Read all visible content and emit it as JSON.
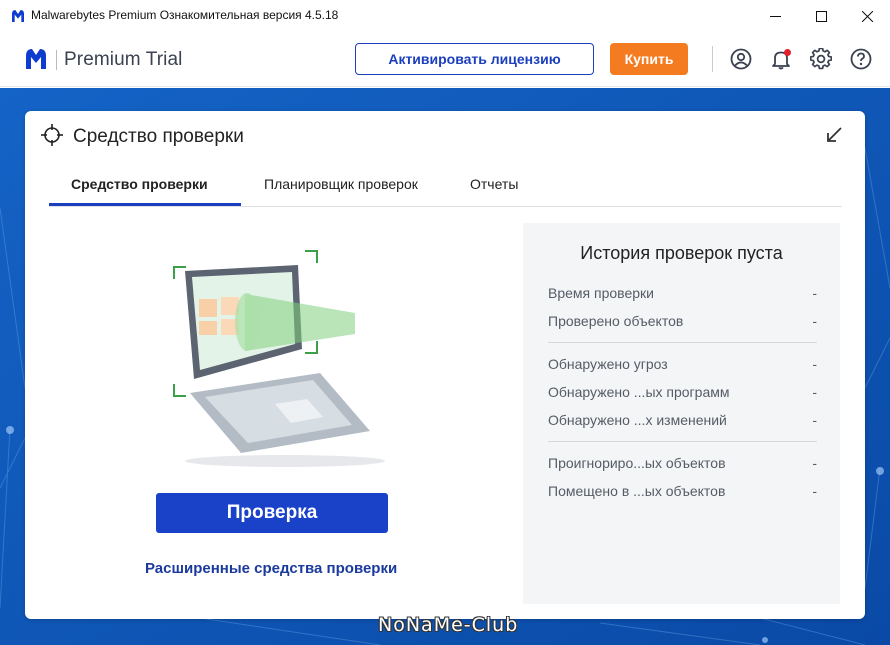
{
  "window": {
    "title": "Malwarebytes Premium Ознакомительная версия  4.5.18"
  },
  "header": {
    "brand": "Premium Trial",
    "activate_label": "Активировать лицензию",
    "buy_label": "Купить",
    "icons": [
      "account-icon",
      "notifications-icon",
      "settings-icon",
      "help-icon"
    ],
    "notification_dot_color": "#e0202a"
  },
  "card": {
    "title": "Средство проверки",
    "tabs": [
      {
        "label": "Средство проверки",
        "active": true
      },
      {
        "label": "Планировщик проверок",
        "active": false
      },
      {
        "label": "Отчеты",
        "active": false
      }
    ],
    "scan_button": "Проверка",
    "advanced_link": "Расширенные средства проверки"
  },
  "history": {
    "title": "История проверок пуста",
    "groups": [
      [
        {
          "label": "Время проверки",
          "value": "-"
        },
        {
          "label": "Проверено объектов",
          "value": "-"
        }
      ],
      [
        {
          "label": "Обнаружено угроз",
          "value": "-"
        },
        {
          "label": "Обнаружено ...ых программ",
          "value": "-"
        },
        {
          "label": "Обнаружено ...х изменений",
          "value": "-"
        }
      ],
      [
        {
          "label": "Проигнориро...ых объектов",
          "value": "-"
        },
        {
          "label": "Помещено в ...ых объектов",
          "value": "-"
        }
      ]
    ]
  },
  "watermark": "NoNaMe-Club",
  "colors": {
    "accent": "#1b3fbd",
    "buy": "#f47b20",
    "background": "#0d58b8"
  }
}
